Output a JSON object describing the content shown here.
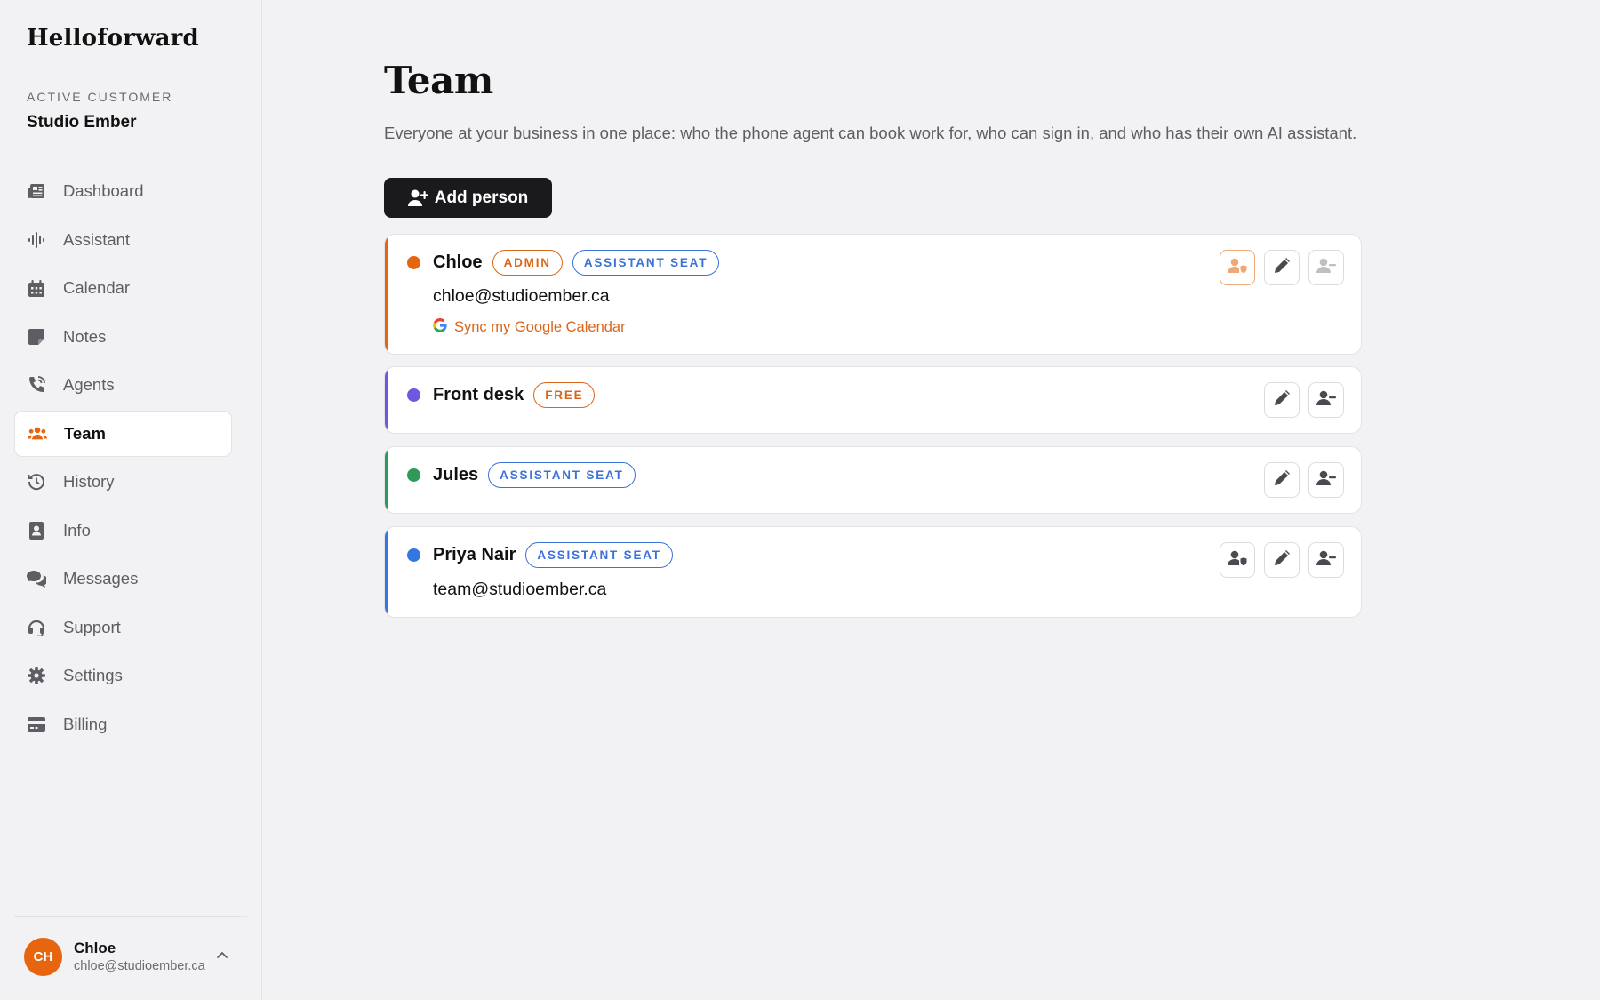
{
  "sidebar": {
    "brand": "Helloforward",
    "customer_label": "ACTIVE CUSTOMER",
    "customer_name": "Studio Ember",
    "items": [
      {
        "label": "Dashboard",
        "icon": "newspaper-icon"
      },
      {
        "label": "Assistant",
        "icon": "waveform-icon"
      },
      {
        "label": "Calendar",
        "icon": "calendar-icon"
      },
      {
        "label": "Notes",
        "icon": "note-icon"
      },
      {
        "label": "Agents",
        "icon": "phone-icon"
      },
      {
        "label": "Team",
        "icon": "users-icon",
        "active": true
      },
      {
        "label": "History",
        "icon": "history-icon"
      },
      {
        "label": "Info",
        "icon": "contact-card-icon"
      },
      {
        "label": "Messages",
        "icon": "chat-icon"
      },
      {
        "label": "Support",
        "icon": "headset-icon"
      },
      {
        "label": "Settings",
        "icon": "gear-icon"
      },
      {
        "label": "Billing",
        "icon": "credit-card-icon"
      }
    ],
    "account": {
      "initials": "CH",
      "name": "Chloe",
      "email": "chloe@studioember.ca"
    }
  },
  "main": {
    "title": "Team",
    "description": "Everyone at your business in one place: who the phone agent can book work for, who can sign in, and who has their own AI assistant.",
    "add_button": "Add person",
    "people": [
      {
        "name": "Chloe",
        "color": "#e8650f",
        "badges": [
          {
            "label": "ADMIN",
            "style": "orange"
          },
          {
            "label": "ASSISTANT SEAT",
            "style": "blue"
          }
        ],
        "email": "chloe@studioember.ca",
        "sync_label": "Sync my Google Calendar",
        "actions": [
          "admin-access-icon",
          "edit-icon",
          "remove-person-icon"
        ]
      },
      {
        "name": "Front desk",
        "color": "#7057e0",
        "badges": [
          {
            "label": "FREE",
            "style": "orange"
          }
        ],
        "actions": [
          "edit-icon",
          "remove-person-icon"
        ]
      },
      {
        "name": "Jules",
        "color": "#2e9a5a",
        "badges": [
          {
            "label": "ASSISTANT SEAT",
            "style": "blue"
          }
        ],
        "actions": [
          "edit-icon",
          "remove-person-icon"
        ]
      },
      {
        "name": "Priya Nair",
        "color": "#3477e0",
        "badges": [
          {
            "label": "ASSISTANT SEAT",
            "style": "blue"
          }
        ],
        "email": "team@studioember.ca",
        "actions": [
          "admin-access-icon",
          "edit-icon",
          "remove-person-icon"
        ]
      }
    ]
  },
  "colors": {
    "accent": "#e8650f",
    "badge_blue": "#3b72d6",
    "button_dark": "#1a1a1c"
  }
}
